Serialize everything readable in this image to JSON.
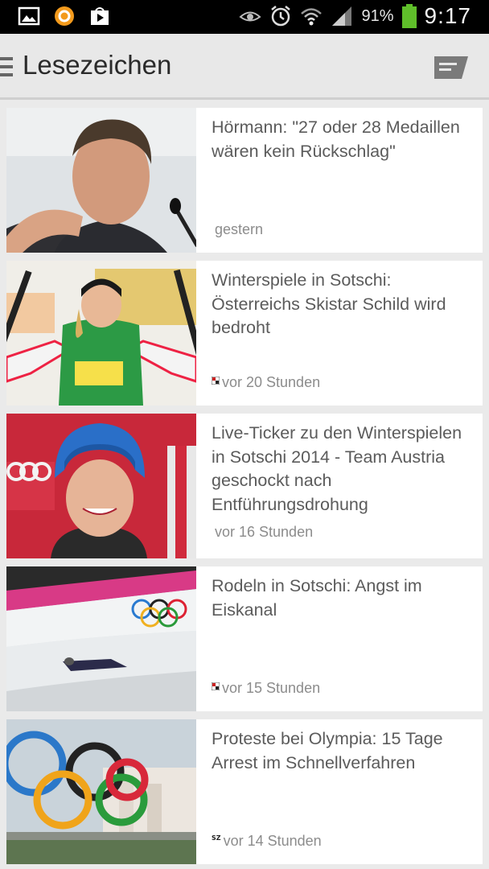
{
  "status_bar": {
    "icons_left": [
      "gallery-icon",
      "sync-circle-icon",
      "play-store-icon"
    ],
    "icons_right": [
      "eye-icon",
      "alarm-icon",
      "wifi-icon",
      "signal-icon"
    ],
    "battery": "91%",
    "time": "9:17",
    "battery_color": "#5fbf2a"
  },
  "action_bar": {
    "title": "Lesezeichen"
  },
  "articles": [
    {
      "title": "Hörmann: \"27 oder 28 Medaillen wären kein Rückschlag\"",
      "time": "gestern",
      "source_icon": "none"
    },
    {
      "title": "Winterspiele in Sotschi: Österreichs Skistar Schild wird bedroht",
      "time": "vor 20 Stunden",
      "source_icon": "source-logo-icon"
    },
    {
      "title": "Live-Ticker zu den Winterspielen in Sotschi 2014 - Team Austria geschockt nach Entführungsdrohung",
      "time": "vor 16 Stunden",
      "source_icon": "none"
    },
    {
      "title": "Rodeln in Sotschi: Angst im Eiskanal",
      "time": "vor 15 Stunden",
      "source_icon": "source-logo-icon"
    },
    {
      "title": "Proteste bei Olympia: 15 Tage Arrest im Schnellverfahren",
      "time": "vor 14 Stunden",
      "source_icon": "sz-logo-icon",
      "source_label": "SZ"
    }
  ]
}
